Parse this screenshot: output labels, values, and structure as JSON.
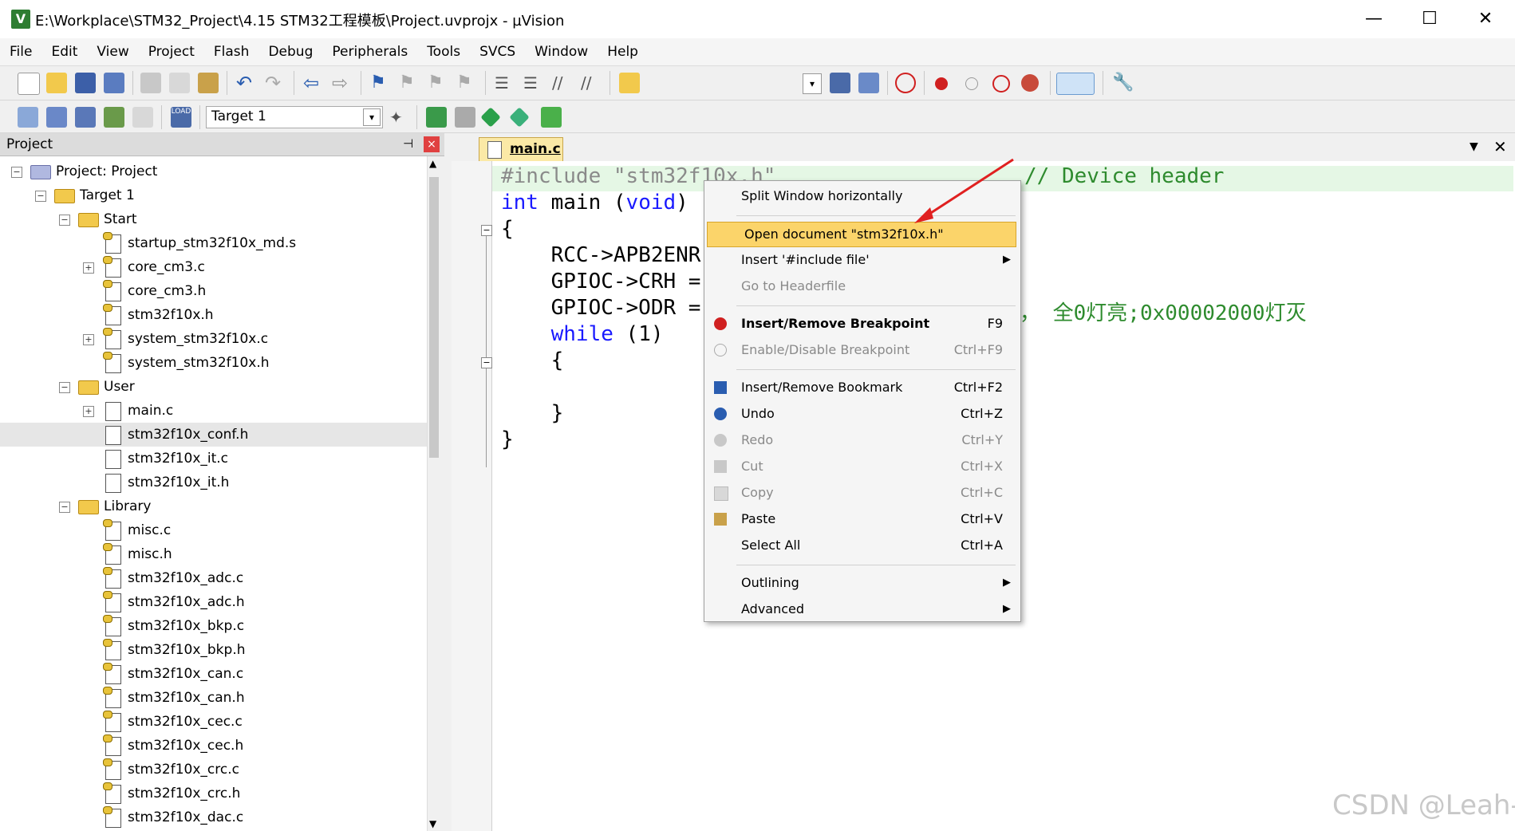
{
  "window": {
    "title": "E:\\Workplace\\STM32_Project\\4.15 STM32工程模板\\Project.uvprojx - µVision",
    "app_icon": "V",
    "minimize": "—",
    "maximize": "☐",
    "close": "✕"
  },
  "menu": [
    "File",
    "Edit",
    "View",
    "Project",
    "Flash",
    "Debug",
    "Peripherals",
    "Tools",
    "SVCS",
    "Window",
    "Help"
  ],
  "toolbar2": {
    "target_select": "Target 1"
  },
  "project_panel": {
    "title": "Project",
    "pin": "⊣",
    "close": "×",
    "tree": [
      {
        "label": "Project: Project",
        "depth": 0,
        "kind": "project",
        "expander": "−"
      },
      {
        "label": "Target 1",
        "depth": 1,
        "kind": "target",
        "expander": "−"
      },
      {
        "label": "Start",
        "depth": 2,
        "kind": "folder",
        "expander": "−"
      },
      {
        "label": "startup_stm32f10x_md.s",
        "depth": 3,
        "kind": "key"
      },
      {
        "label": "core_cm3.c",
        "depth": 3,
        "kind": "key",
        "expander": "+"
      },
      {
        "label": "core_cm3.h",
        "depth": 3,
        "kind": "key"
      },
      {
        "label": "stm32f10x.h",
        "depth": 3,
        "kind": "key"
      },
      {
        "label": "system_stm32f10x.c",
        "depth": 3,
        "kind": "key",
        "expander": "+"
      },
      {
        "label": "system_stm32f10x.h",
        "depth": 3,
        "kind": "key"
      },
      {
        "label": "User",
        "depth": 2,
        "kind": "folder",
        "expander": "−"
      },
      {
        "label": "main.c",
        "depth": 3,
        "kind": "file",
        "expander": "+"
      },
      {
        "label": "stm32f10x_conf.h",
        "depth": 3,
        "kind": "file",
        "selected": true
      },
      {
        "label": "stm32f10x_it.c",
        "depth": 3,
        "kind": "file"
      },
      {
        "label": "stm32f10x_it.h",
        "depth": 3,
        "kind": "file"
      },
      {
        "label": "Library",
        "depth": 2,
        "kind": "folder",
        "expander": "−"
      },
      {
        "label": "misc.c",
        "depth": 3,
        "kind": "key"
      },
      {
        "label": "misc.h",
        "depth": 3,
        "kind": "key"
      },
      {
        "label": "stm32f10x_adc.c",
        "depth": 3,
        "kind": "key"
      },
      {
        "label": "stm32f10x_adc.h",
        "depth": 3,
        "kind": "key"
      },
      {
        "label": "stm32f10x_bkp.c",
        "depth": 3,
        "kind": "key"
      },
      {
        "label": "stm32f10x_bkp.h",
        "depth": 3,
        "kind": "key"
      },
      {
        "label": "stm32f10x_can.c",
        "depth": 3,
        "kind": "key"
      },
      {
        "label": "stm32f10x_can.h",
        "depth": 3,
        "kind": "key"
      },
      {
        "label": "stm32f10x_cec.c",
        "depth": 3,
        "kind": "key"
      },
      {
        "label": "stm32f10x_cec.h",
        "depth": 3,
        "kind": "key"
      },
      {
        "label": "stm32f10x_crc.c",
        "depth": 3,
        "kind": "key"
      },
      {
        "label": "stm32f10x_crc.h",
        "depth": 3,
        "kind": "key"
      },
      {
        "label": "stm32f10x_dac.c",
        "depth": 3,
        "kind": "key"
      }
    ]
  },
  "editor": {
    "tab": "main.c",
    "lines": [
      {
        "segments": [
          {
            "t": "#include \"stm32f10x.h\"",
            "c": "#8a8a8a"
          }
        ]
      },
      {
        "segments": [
          {
            "t": "int",
            "c": "#1a1aff"
          },
          {
            "t": " main (",
            "c": "#000000"
          },
          {
            "t": "void",
            "c": "#1a1aff"
          },
          {
            "t": ")",
            "c": "#000000"
          }
        ]
      },
      {
        "segments": [
          {
            "t": "{",
            "c": "#000000"
          }
        ]
      },
      {
        "segments": [
          {
            "t": "    RCC->APB2ENR",
            "c": "#000000"
          }
        ]
      },
      {
        "segments": [
          {
            "t": "    GPIOC->CRH =",
            "c": "#000000"
          }
        ]
      },
      {
        "segments": [
          {
            "t": "    GPIOC->ODR =",
            "c": "#000000"
          }
        ]
      },
      {
        "segments": [
          {
            "t": "    ",
            "c": "#000000"
          },
          {
            "t": "while",
            "c": "#1a1aff"
          },
          {
            "t": " (1)",
            "c": "#000000"
          }
        ]
      },
      {
        "segments": [
          {
            "t": "    {",
            "c": "#000000"
          }
        ]
      },
      {
        "segments": [
          {
            "t": "",
            "c": "#000000"
          }
        ]
      },
      {
        "segments": [
          {
            "t": "    }",
            "c": "#000000"
          }
        ]
      },
      {
        "segments": [
          {
            "t": "}",
            "c": "#000000"
          }
        ]
      }
    ],
    "comment_line1": "// Device header",
    "comment_line6": "， 全0灯亮;0x00002000灯灭",
    "comment_color": "#2e8b2e"
  },
  "context_menu": {
    "items": [
      {
        "label": "Split Window horizontally",
        "shortcut": "",
        "state": "normal"
      },
      {
        "sep": true
      },
      {
        "label": "Open document \"stm32f10x.h\"",
        "shortcut": "",
        "state": "highlighted"
      },
      {
        "label": "Insert '#include file'",
        "shortcut": "",
        "state": "normal",
        "submenu": true
      },
      {
        "label": "Go to Headerfile",
        "shortcut": "",
        "state": "disabled"
      },
      {
        "sep": true
      },
      {
        "label": "Insert/Remove Breakpoint",
        "shortcut": "F9",
        "state": "bold",
        "icon": "breakpoint-icon"
      },
      {
        "label": "Enable/Disable Breakpoint",
        "shortcut": "Ctrl+F9",
        "state": "disabled",
        "icon": "breakpoint-toggle-icon"
      },
      {
        "sep": true
      },
      {
        "label": "Insert/Remove Bookmark",
        "shortcut": "Ctrl+F2",
        "state": "normal",
        "icon": "bookmark-icon"
      },
      {
        "label": "Undo",
        "shortcut": "Ctrl+Z",
        "state": "normal",
        "icon": "undo-icon"
      },
      {
        "label": "Redo",
        "shortcut": "Ctrl+Y",
        "state": "disabled",
        "icon": "redo-icon"
      },
      {
        "label": "Cut",
        "shortcut": "Ctrl+X",
        "state": "disabled",
        "icon": "cut-icon"
      },
      {
        "label": "Copy",
        "shortcut": "Ctrl+C",
        "state": "disabled",
        "icon": "copy-icon"
      },
      {
        "label": "Paste",
        "shortcut": "Ctrl+V",
        "state": "normal",
        "icon": "paste-icon"
      },
      {
        "label": "Select All",
        "shortcut": "Ctrl+A",
        "state": "normal"
      },
      {
        "sep": true
      },
      {
        "label": "Outlining",
        "shortcut": "",
        "state": "normal",
        "submenu": true
      },
      {
        "label": "Advanced",
        "shortcut": "",
        "state": "normal",
        "submenu": true
      }
    ]
  },
  "watermark": "CSDN @Leah-",
  "colors": {
    "highlight": "#fbd46a",
    "annotation_arrow": "#e02020"
  }
}
